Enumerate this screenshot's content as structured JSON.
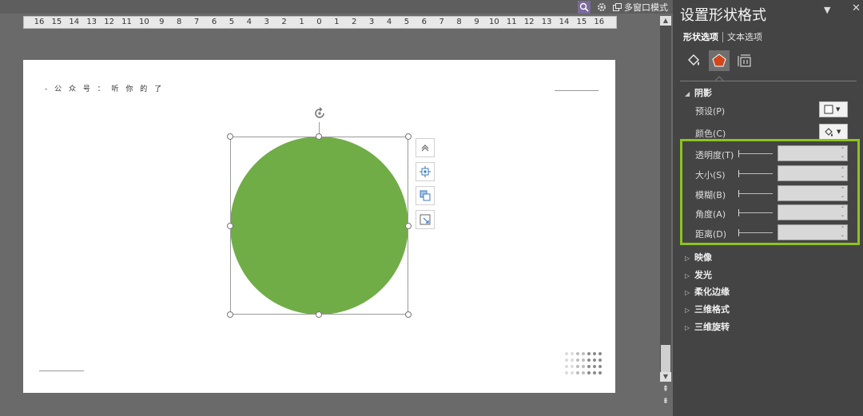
{
  "toolbar": {
    "multiwindow_label": "多窗口模式",
    "icons": [
      "zoom-icon",
      "gear-icon",
      "window-icon"
    ]
  },
  "ruler": {
    "ticks": [
      "16",
      "15",
      "14",
      "13",
      "12",
      "11",
      "10",
      "9",
      "8",
      "7",
      "6",
      "5",
      "4",
      "3",
      "2",
      "1",
      "0",
      "1",
      "2",
      "3",
      "4",
      "5",
      "6",
      "7",
      "8",
      "9",
      "10",
      "11",
      "12",
      "13",
      "14",
      "15",
      "16"
    ]
  },
  "slide": {
    "source_text": "- 公 众 号 ： 听 你 的 了",
    "shape_color": "#70ad47"
  },
  "pane": {
    "title": "设置形状格式",
    "tabs": {
      "shape_options": "形状选项",
      "text_options": "文本选项"
    },
    "category_icons": [
      "fill-line-icon",
      "effects-pentagon-icon",
      "size-properties-icon"
    ],
    "shadow": {
      "header": "阴影",
      "preset_label": "预设(P)",
      "color_label": "颜色(C)",
      "params": [
        {
          "label": "透明度(T)",
          "value": ""
        },
        {
          "label": "大小(S)",
          "value": ""
        },
        {
          "label": "模糊(B)",
          "value": ""
        },
        {
          "label": "角度(A)",
          "value": ""
        },
        {
          "label": "距离(D)",
          "value": ""
        }
      ]
    },
    "sections": [
      "映像",
      "发光",
      "柔化边缘",
      "三维格式",
      "三维旋转"
    ],
    "highlight_color": "#8dc21f"
  }
}
